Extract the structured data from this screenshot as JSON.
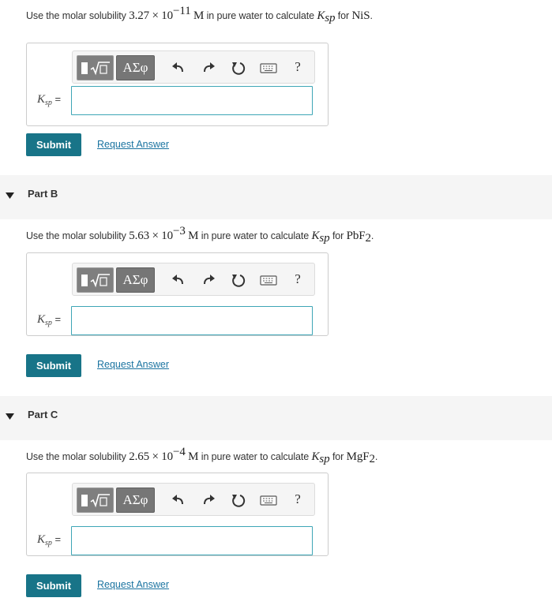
{
  "parts": [
    {
      "header": "",
      "question": {
        "prefix": "Use the molar solubility",
        "coefficient": "3.27",
        "times": "×",
        "base": "10",
        "exponent": "−11",
        "unit": "M",
        "middle": "in pure water to calculate",
        "k_symbol": "K",
        "k_subscript": "sp",
        "for_text": "for",
        "compound_main": "NiS",
        "compound_subscript": "",
        "end": "."
      },
      "answer": {
        "label_symbol": "K",
        "label_subscript": "sp",
        "equals": "=",
        "value": ""
      },
      "submit_label": "Submit",
      "request_label": "Request Answer"
    },
    {
      "header": "Part B",
      "question": {
        "prefix": "Use the molar solubility",
        "coefficient": "5.63",
        "times": "×",
        "base": "10",
        "exponent": "−3",
        "unit": "M",
        "middle": "in pure water to calculate",
        "k_symbol": "K",
        "k_subscript": "sp",
        "for_text": "for",
        "compound_main": "PbF",
        "compound_subscript": "2",
        "end": "."
      },
      "answer": {
        "label_symbol": "K",
        "label_subscript": "sp",
        "equals": "=",
        "value": ""
      },
      "submit_label": "Submit",
      "request_label": "Request Answer"
    },
    {
      "header": "Part C",
      "question": {
        "prefix": "Use the molar solubility",
        "coefficient": "2.65",
        "times": "×",
        "base": "10",
        "exponent": "−4",
        "unit": "M",
        "middle": "in pure water to calculate",
        "k_symbol": "K",
        "k_subscript": "sp",
        "for_text": "for",
        "compound_main": "MgF",
        "compound_subscript": "2",
        "end": "."
      },
      "answer": {
        "label_symbol": "K",
        "label_subscript": "sp",
        "equals": "=",
        "value": ""
      },
      "submit_label": "Submit",
      "request_label": "Request Answer"
    }
  ],
  "toolbar": {
    "greek_label": "ΑΣφ",
    "help_label": "?",
    "icons": [
      "templates-icon",
      "undo-icon",
      "redo-icon",
      "reset-icon",
      "keyboard-icon",
      "help-icon"
    ]
  },
  "colors": {
    "submit_bg": "#187488",
    "link": "#1a73a0",
    "input_border": "#3ea6b6",
    "part_header_bg": "#f5f5f5"
  }
}
